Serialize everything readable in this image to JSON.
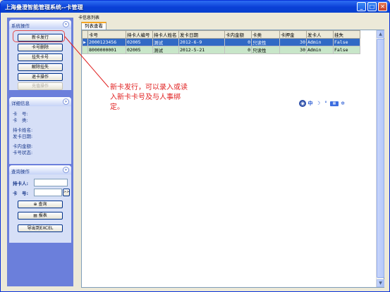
{
  "window": {
    "title": "上海叠澄智能管理系统--卡管理"
  },
  "left": {
    "ops": {
      "title": "系统操作",
      "buttons": [
        "新卡发行",
        "卡号删除",
        "挂失卡号",
        "解除挂失",
        "退卡操作",
        "充值操作"
      ]
    },
    "detail": {
      "title": "详细信息",
      "lines": [
        "卡　号:",
        "卡　类:",
        "持卡姓名:",
        "发卡日期:",
        "卡内金额:",
        "卡号状态:"
      ]
    },
    "query": {
      "title": "查询操作",
      "holder_label": "持卡人:",
      "card_label": "卡　号:",
      "pick_label": ">>",
      "query_btn": "查询",
      "report_btn": "报表",
      "export_btn": "导出到EXCEL"
    }
  },
  "right": {
    "title": "卡信息列表",
    "tab": "列表查看"
  },
  "table": {
    "headers": [
      "卡号",
      "持卡人编号",
      "持卡人姓名",
      "发卡日期",
      "卡内金额",
      "卡类",
      "卡押金",
      "发卡人",
      "挂失"
    ],
    "rows": [
      [
        "2000123456",
        "02005",
        "测试",
        "2012-6-9",
        "0",
        "只读性",
        "30",
        "Admin",
        "False"
      ],
      [
        "8000000001",
        "02005",
        "测试",
        "2012-5-21",
        "0",
        "只读性",
        "30",
        "Admin",
        "False"
      ]
    ]
  },
  "annotation": "新卡发行，可以录入或读入新卡卡号及与人事绑定。",
  "ime": {
    "label": "中"
  }
}
